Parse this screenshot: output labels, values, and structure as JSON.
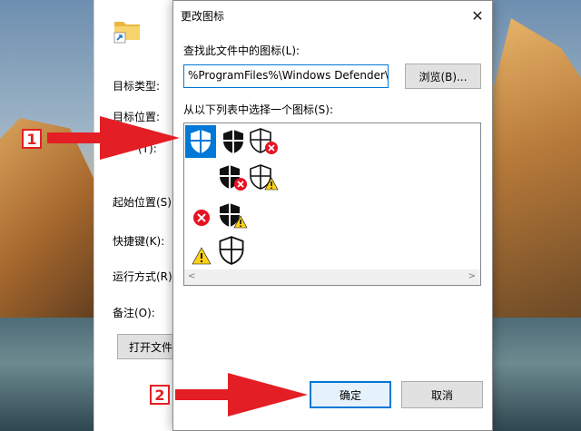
{
  "properties_window": {
    "labels": {
      "target_type": "目标类型:",
      "target_location": "目标位置:",
      "target": "(T):",
      "start_in": "起始位置(S):",
      "shortcut_key": "快捷键(K):",
      "run": "运行方式(R):",
      "comment": "备注(O):"
    },
    "open_file_button": "打开文件"
  },
  "dialog": {
    "title": "更改图标",
    "search_label": "查找此文件中的图标(L):",
    "path_value": "%ProgramFiles%\\Windows Defender\\E",
    "browse_label": "浏览(B)...",
    "list_label": "从以下列表中选择一个图标(S):",
    "ok_label": "确定",
    "cancel_label": "取消"
  },
  "annotations": {
    "step1": "1",
    "step2": "2"
  },
  "colors": {
    "accent": "#0078d7",
    "annotation_red": "#e31e24"
  },
  "icons": [
    "shield-selected-icon",
    "shield-black-icon",
    "shield-error-icon",
    "shield-error-black-icon",
    "shield-warning-icon",
    "error-icon",
    "shield-warning-black-icon",
    "warning-icon",
    "shield-outline-icon"
  ]
}
